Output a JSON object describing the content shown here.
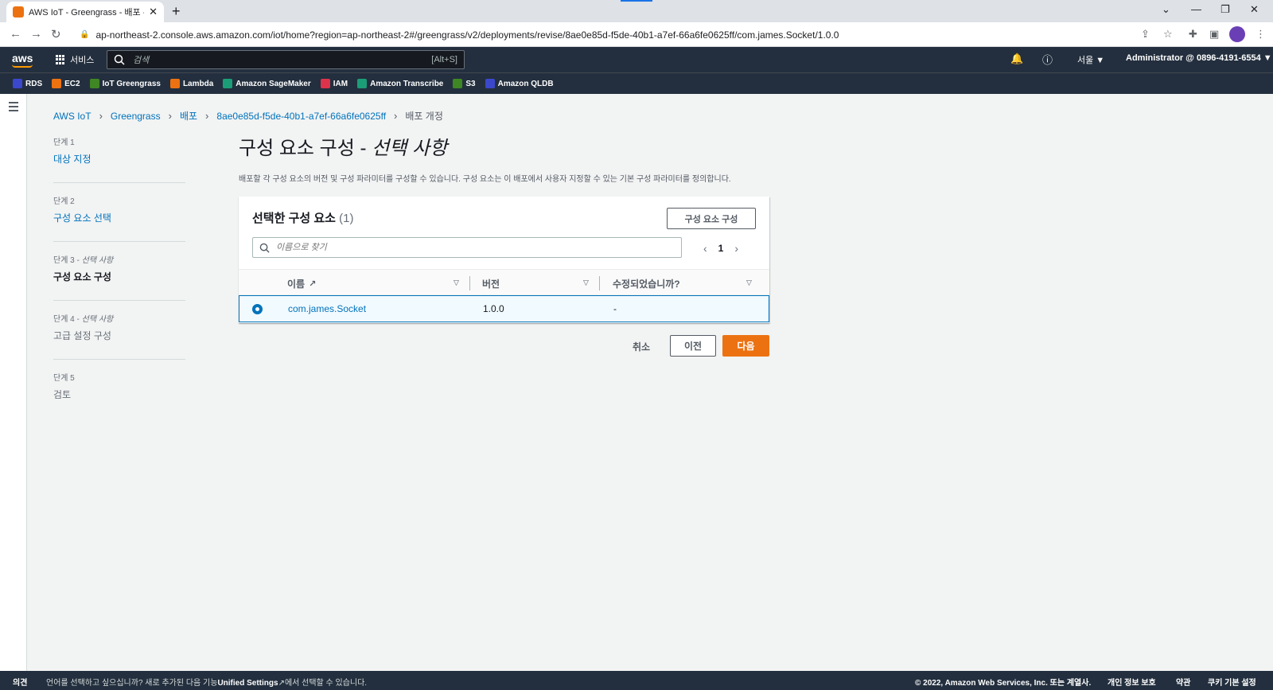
{
  "browser": {
    "tab_title": "AWS IoT - Greengrass - 배포 - ",
    "url": "ap-northeast-2.console.aws.amazon.com/iot/home?region=ap-northeast-2#/greengrass/v2/deployments/revise/8ae0e85d-f5de-40b1-a7ef-66a6fe0625ff/com.james.Socket/1.0.0"
  },
  "aws_header": {
    "logo": "aws",
    "services": "서비스",
    "search_placeholder": "검색",
    "search_shortcut": "[Alt+S]",
    "region": "서울 ▼",
    "account": "Administrator @ 0896-4191-6554 ▼"
  },
  "favorites": [
    {
      "label": "RDS",
      "color": "#3b48cc"
    },
    {
      "label": "EC2",
      "color": "#ec7211"
    },
    {
      "label": "IoT Greengrass",
      "color": "#3f8624"
    },
    {
      "label": "Lambda",
      "color": "#ec7211"
    },
    {
      "label": "Amazon SageMaker",
      "color": "#1b9e77"
    },
    {
      "label": "IAM",
      "color": "#dd344c"
    },
    {
      "label": "Amazon Transcribe",
      "color": "#1b9e77"
    },
    {
      "label": "S3",
      "color": "#3f8624"
    },
    {
      "label": "Amazon QLDB",
      "color": "#3b48cc"
    }
  ],
  "breadcrumb": {
    "items": [
      "AWS IoT",
      "Greengrass",
      "배포",
      "8ae0e85d-f5de-40b1-a7ef-66a6fe0625ff"
    ],
    "current": "배포 개정"
  },
  "steps": [
    {
      "num": "단계 1",
      "optional": "",
      "label": "대상 지정"
    },
    {
      "num": "단계 2",
      "optional": "",
      "label": "구성 요소 선택"
    },
    {
      "num": "단계 3 - ",
      "optional": "선택 사항",
      "label": "구성 요소 구성"
    },
    {
      "num": "단계 4 - ",
      "optional": "선택 사항",
      "label": "고급 설정 구성"
    },
    {
      "num": "단계 5",
      "optional": "",
      "label": "검토"
    }
  ],
  "main": {
    "title": "구성 요소 구성 - ",
    "title_optional": "선택 사항",
    "description": "배포할 각 구성 요소의 버전 및 구성 파라미터를 구성할 수 있습니다. 구성 요소는 이 배포에서 사용자 지정할 수 있는 기본 구성 파라미터를 정의합니다."
  },
  "panel": {
    "title": "선택한 구성 요소",
    "count": "(1)",
    "configure_button": "구성 요소 구성",
    "filter_placeholder": "이름으로 찾기",
    "page": "1",
    "columns": [
      "이름",
      "버전",
      "수정되었습니까?"
    ],
    "rows": [
      {
        "name": "com.james.Socket",
        "version": "1.0.0",
        "modified": "-"
      }
    ]
  },
  "actions": {
    "cancel": "취소",
    "previous": "이전",
    "next": "다음"
  },
  "footer": {
    "feedback": "의견",
    "language_prefix": "언어를 선택하고 싶으십니까? 새로 추가된 다음 기능",
    "language_link": "Unified Settings",
    "language_suffix": "에서 선택할 수 있습니다.",
    "copyright": "© 2022, Amazon Web Services, Inc. 또는 계열사.",
    "privacy": "개인 정보 보호",
    "terms": "약관",
    "cookies": "쿠키 기본 설정"
  },
  "colors": {
    "aws_dark": "#232f3e",
    "link": "#0073bb",
    "primary": "#ec7211"
  }
}
